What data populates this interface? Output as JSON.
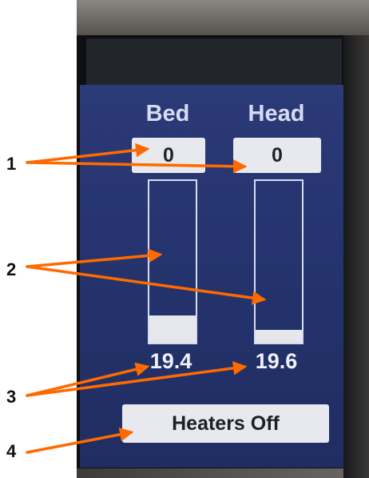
{
  "headings": {
    "bed": "Bed",
    "head": "Head"
  },
  "setpoints": {
    "bed": "0",
    "head": "0"
  },
  "temperatures": {
    "bed": "19.4",
    "head": "19.6"
  },
  "gauge_levels": {
    "bed": 0.17,
    "head": 0.08
  },
  "heater_button": {
    "label": "Heaters Off"
  },
  "callouts": [
    "1",
    "2",
    "3",
    "4"
  ],
  "colors": {
    "panel": "#2b3a78",
    "arrow": "#ff6a00",
    "box": "#e8e9ee"
  }
}
